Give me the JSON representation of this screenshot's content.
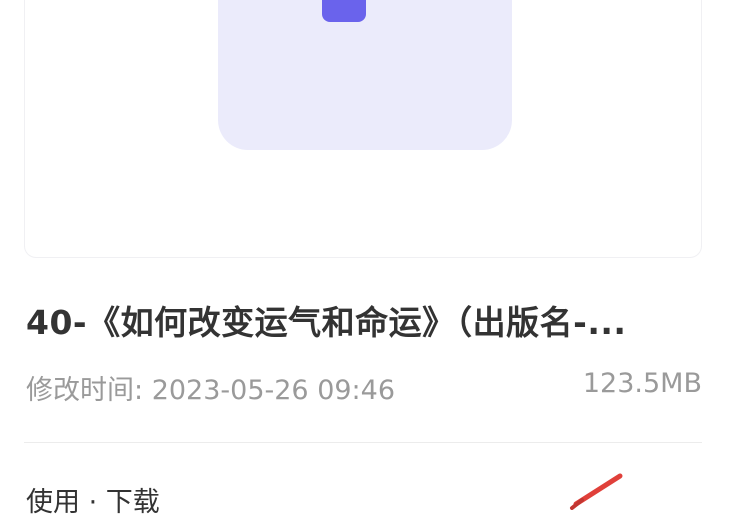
{
  "file": {
    "title": "40-《如何改变运气和命运》（出版名-...",
    "modified_label": "修改时间:",
    "modified_time": "2023-05-26 09:46",
    "size": "123.5MB",
    "thumbnail_icon": "document-icon",
    "accent_color": "#6a63ec",
    "thumbnail_bg": "#ebebfb"
  },
  "footer": {
    "source_text": "使用 · 下载",
    "action_icon": "edit-icon",
    "action_color": "#e0403a"
  }
}
